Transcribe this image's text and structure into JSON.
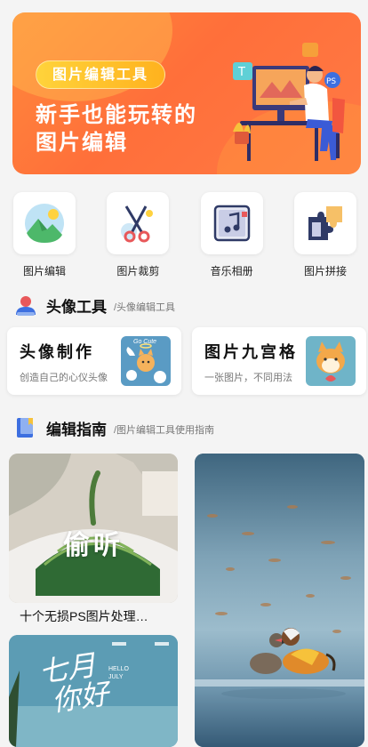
{
  "banner": {
    "pill_label": "图片编辑工具",
    "headline_line1": "新手也能玩转的",
    "headline_line2": "图片编辑"
  },
  "tools": [
    {
      "label": "图片编辑",
      "icon": "landscape-photo-icon"
    },
    {
      "label": "图片裁剪",
      "icon": "scissors-icon"
    },
    {
      "label": "音乐相册",
      "icon": "music-album-icon"
    },
    {
      "label": "图片拼接",
      "icon": "puzzle-icon"
    }
  ],
  "avatar_section": {
    "title": "头像工具",
    "subtitle": "/头像编辑工具"
  },
  "cards": [
    {
      "title": "头像制作",
      "desc": "创造自己的心仪头像",
      "badge": "Go Cute"
    },
    {
      "title": "图片九宫格",
      "desc": "一张图片，不同用法"
    }
  ],
  "guide_section": {
    "title": "编辑指南",
    "subtitle": "/图片编辑工具使用指南"
  },
  "guides": [
    {
      "overlay": "偷听",
      "caption": "十个无损PS图片处理…"
    },
    {
      "overlay_line1": "七月",
      "overlay_line2": "你好",
      "tag": "HELLO JULY"
    }
  ],
  "colors": {
    "banner": "#ff7a40",
    "pill": "#ffc42b",
    "background": "#f4f4f4"
  }
}
